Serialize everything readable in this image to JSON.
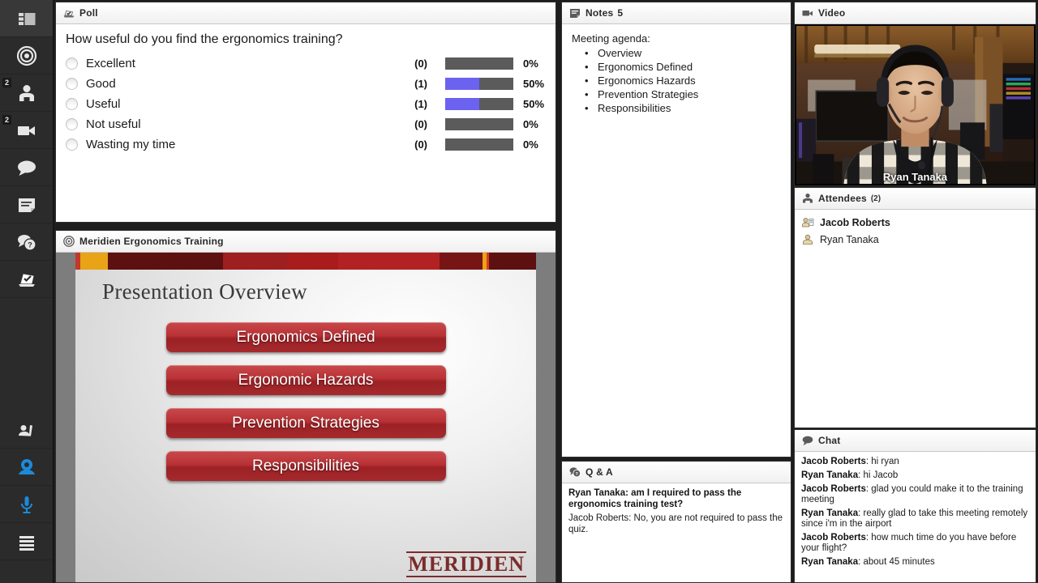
{
  "sidebar": {
    "items": [
      {
        "name": "layout-icon",
        "badge": null,
        "selected": true,
        "active": false
      },
      {
        "name": "target-icon",
        "badge": null,
        "selected": false,
        "active": false
      },
      {
        "name": "attendees-icon",
        "badge": "2",
        "selected": false,
        "active": false
      },
      {
        "name": "video-camera-icon",
        "badge": "2",
        "selected": false,
        "active": false
      },
      {
        "name": "chat-bubble-icon",
        "badge": null,
        "selected": false,
        "active": false
      },
      {
        "name": "notes-icon",
        "badge": null,
        "selected": false,
        "active": false
      },
      {
        "name": "qa-icon",
        "badge": null,
        "selected": false,
        "active": false
      },
      {
        "name": "poll-icon",
        "badge": null,
        "selected": false,
        "active": false
      },
      {
        "name": "raise-hand-icon",
        "badge": null,
        "selected": false,
        "active": false
      },
      {
        "name": "webcam-icon",
        "badge": null,
        "selected": false,
        "active": true
      },
      {
        "name": "microphone-icon",
        "badge": null,
        "selected": false,
        "active": true
      },
      {
        "name": "menu-icon",
        "badge": null,
        "selected": false,
        "active": false
      }
    ]
  },
  "poll": {
    "title": "Poll",
    "question": "How useful do you find the ergonomics training?",
    "options": [
      {
        "label": "Excellent",
        "count": "(0)",
        "percent": "0%",
        "fill": 0
      },
      {
        "label": "Good",
        "count": "(1)",
        "percent": "50%",
        "fill": 50
      },
      {
        "label": "Useful",
        "count": "(1)",
        "percent": "50%",
        "fill": 50
      },
      {
        "label": "Not useful",
        "count": "(0)",
        "percent": "0%",
        "fill": 0
      },
      {
        "label": "Wasting my time",
        "count": "(0)",
        "percent": "0%",
        "fill": 0
      }
    ],
    "bar_empty_color": "#5b5b5b",
    "bar_fill_color": "#6b62f0"
  },
  "presentation": {
    "title": "Meridien Ergonomics Training",
    "slide_title": "Presentation Overview",
    "buttons": [
      "Ergonomics Defined",
      "Ergonomic Hazards",
      "Prevention Strategies",
      "Responsibilities"
    ],
    "logo": "MERIDIEN",
    "stripes": [
      {
        "color": "#c0392b",
        "w": 1.2
      },
      {
        "color": "#e8a317",
        "w": 6.5
      },
      {
        "color": "#5d1010",
        "w": 27
      },
      {
        "color": "#9e1f1f",
        "w": 15
      },
      {
        "color": "#a81c1c",
        "w": 12
      },
      {
        "color": "#b22222",
        "w": 24
      },
      {
        "color": "#771414",
        "w": 10
      },
      {
        "color": "#e8a317",
        "w": 0.9
      },
      {
        "color": "#d83b1e",
        "w": 0.7
      },
      {
        "color": "#5d1010",
        "w": 11
      }
    ]
  },
  "notes": {
    "title": "Notes",
    "count": "5",
    "lead": "Meeting agenda:",
    "items": [
      "Overview",
      "Ergonomics Defined",
      "Ergonomics Hazards",
      "Prevention Strategies",
      "Responsibilities"
    ]
  },
  "qa": {
    "title": "Q & A",
    "question": "Ryan Tanaka: am I required to pass the ergonomics training test?",
    "answer": "Jacob Roberts: No, you are not required to pass the quiz."
  },
  "video": {
    "title": "Video",
    "speaker_name": "Ryan Tanaka"
  },
  "attendees": {
    "title": "Attendees",
    "count": "(2)",
    "people": [
      {
        "name": "Jacob Roberts",
        "role": "host"
      },
      {
        "name": "Ryan Tanaka",
        "role": "participant"
      }
    ]
  },
  "chat": {
    "title": "Chat",
    "messages": [
      {
        "sender": "Jacob Roberts",
        "text": "hi ryan"
      },
      {
        "sender": "Ryan Tanaka",
        "text": "hi Jacob"
      },
      {
        "sender": "Jacob Roberts",
        "text": "glad you could make it to the training meeting"
      },
      {
        "sender": "Ryan Tanaka",
        "text": "really glad to take this meeting remotely since i'm in the airport"
      },
      {
        "sender": "Jacob Roberts",
        "text": "how much time do you have before your flight?"
      },
      {
        "sender": "Ryan Tanaka",
        "text": "about 45 minutes"
      }
    ]
  }
}
